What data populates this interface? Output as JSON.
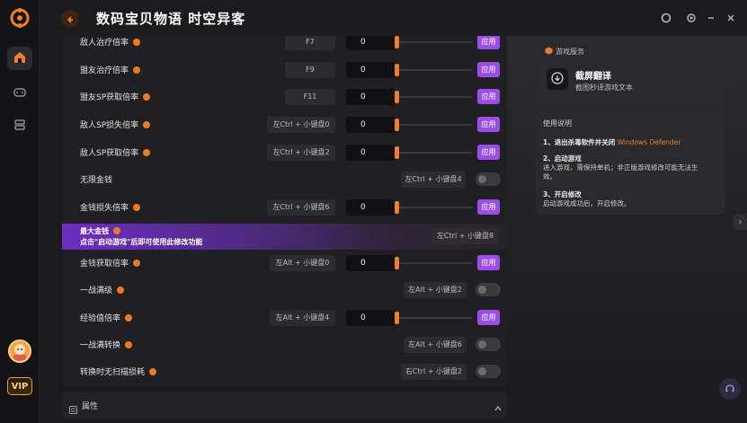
{
  "app": {
    "title": "数码宝贝物语 时空异客",
    "vip_label": "VIP"
  },
  "rows": [
    {
      "label": "敌人治疗倍率",
      "key": "F7",
      "value": "0",
      "apply": "应用"
    },
    {
      "label": "盟友治疗倍率",
      "key": "F9",
      "value": "0",
      "apply": "应用"
    },
    {
      "label": "盟友SP获取倍率",
      "key": "F11",
      "value": "0",
      "apply": "应用"
    },
    {
      "label": "敌人SP损失倍率",
      "key": "左Ctrl + 小键盘0",
      "value": "0",
      "apply": "应用"
    },
    {
      "label": "敌人SP获取倍率",
      "key": "左Ctrl + 小键盘2",
      "value": "0",
      "apply": "应用"
    },
    {
      "label": "无限金钱",
      "key": "左Ctrl + 小键盘4"
    },
    {
      "label": "金钱损失倍率",
      "key": "左Ctrl + 小键盘6",
      "value": "0",
      "apply": "应用"
    },
    {
      "label": "金钱获取倍率",
      "key": "左Alt + 小键盘0",
      "value": "0",
      "apply": "应用"
    },
    {
      "label": "一战满级",
      "key": "左Alt + 小键盘2"
    },
    {
      "label": "经验值倍率",
      "key": "左Alt + 小键盘4",
      "value": "0",
      "apply": "应用"
    },
    {
      "label": "一战满转换",
      "key": "左Alt + 小键盘6"
    },
    {
      "label": "转换时无扫描损耗",
      "key": "右Ctrl + 小键盘2"
    }
  ],
  "promo": {
    "title": "最大金钱",
    "subtitle": "点击\"启动游戏\"后即可使用此修改功能",
    "key": "左Ctrl + 小键盘8"
  },
  "properties": {
    "label": "属性"
  },
  "services": {
    "heading": "游戏服务",
    "name": "截屏翻译",
    "desc": "截图秒译游戏文本"
  },
  "instructions": {
    "heading": "使用说明",
    "step1_title": "1、退出杀毒软件并关闭",
    "step1_highlight": "Windows Defender",
    "step2_title": "2、启动游戏",
    "step2_line1": "进入游戏，需保持单机；非正版游戏修改可能无法生",
    "step2_line2": "效。",
    "step3_title": "3、开启修改",
    "step3_line1": "启动游戏成功后，开启修改。"
  },
  "colors": {
    "accent_orange": "#ea7a23",
    "apply_purple": "#9b4de8",
    "highlight_orange": "#e8802e"
  }
}
